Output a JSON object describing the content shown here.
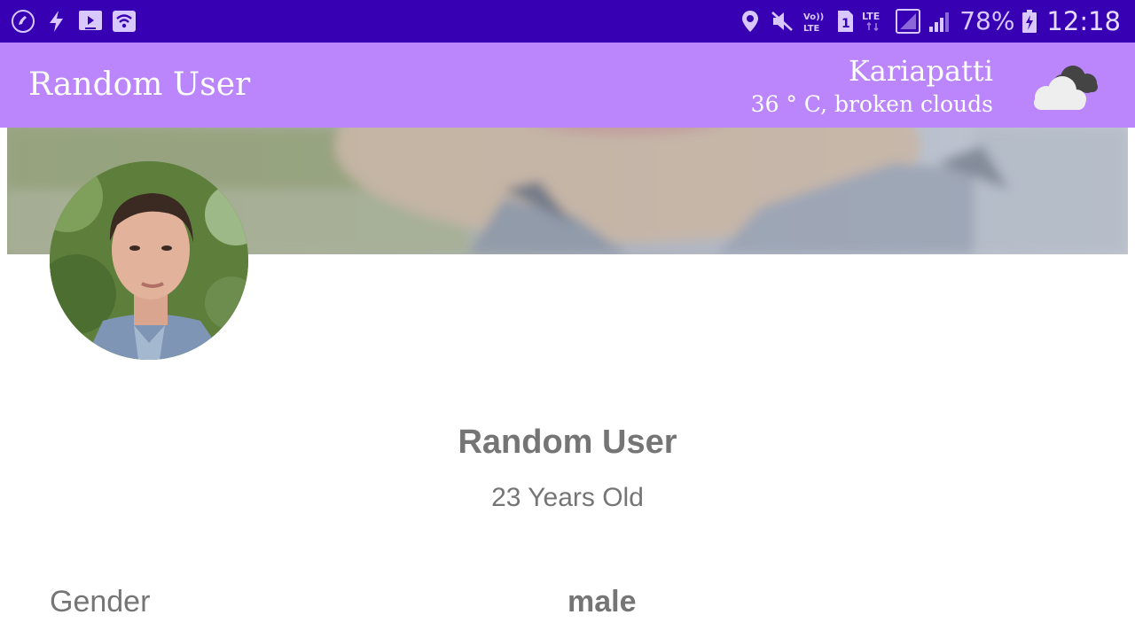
{
  "status_bar": {
    "battery": "78%",
    "time": "12:18",
    "left_icons": [
      "phone-call-icon",
      "flash-icon",
      "tv-icon",
      "wifi-icon"
    ],
    "right_icons": [
      "location-icon",
      "mute-icon",
      "volte-icon",
      "sim-1-icon",
      "lte-signal-icon",
      "signal-icon",
      "battery-charging-icon"
    ]
  },
  "app_bar": {
    "title": "Random User",
    "weather": {
      "city": "Kariapatti",
      "description": "36 ° C, broken clouds",
      "icon": "broken-clouds-icon"
    }
  },
  "profile": {
    "name": "Random User",
    "age": "23 Years Old",
    "details": [
      {
        "label": "Gender",
        "value": "male"
      }
    ]
  },
  "colors": {
    "status_bar": "#3700b3",
    "app_bar": "#bb86fc",
    "text_gray": "#757575"
  }
}
